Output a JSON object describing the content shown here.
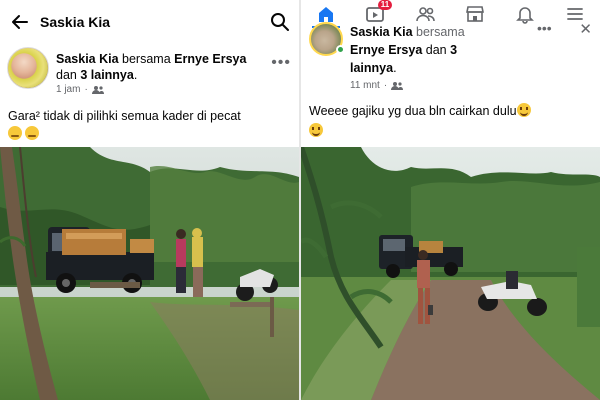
{
  "left": {
    "page_title": "Saskia Kia",
    "post": {
      "author": "Saskia Kia",
      "with_word": "bersama",
      "tagged": "Ernye Ersya",
      "and_word": "dan",
      "others": "3 lainnya",
      "time": "1 jam",
      "text": "Gara² tidak di pilihki semua kader di pecat",
      "emojis": [
        "pensive-face-icon",
        "pensive-face-icon"
      ]
    }
  },
  "right": {
    "tabs": [
      {
        "name": "home-icon",
        "active": true
      },
      {
        "name": "video-icon",
        "badge": "11"
      },
      {
        "name": "friends-icon"
      },
      {
        "name": "marketplace-icon"
      },
      {
        "name": "notifications-icon"
      },
      {
        "name": "menu-icon"
      }
    ],
    "badge_count": "11",
    "post": {
      "author": "Saskia Kia",
      "with_word": "bersama",
      "tagged": "Ernye Ersya",
      "and_word": "dan",
      "others_a": "3",
      "others_b": "lainnya",
      "time": "11 mnt",
      "text": "Weeee gajiku yg dua bln cairkan dulu",
      "emojis": [
        "smiling-face-icon",
        "smiling-face-icon"
      ]
    }
  },
  "colors": {
    "accent": "#1877f2",
    "badge": "#e41e3f",
    "text": "#050505",
    "muted": "#65676b"
  }
}
